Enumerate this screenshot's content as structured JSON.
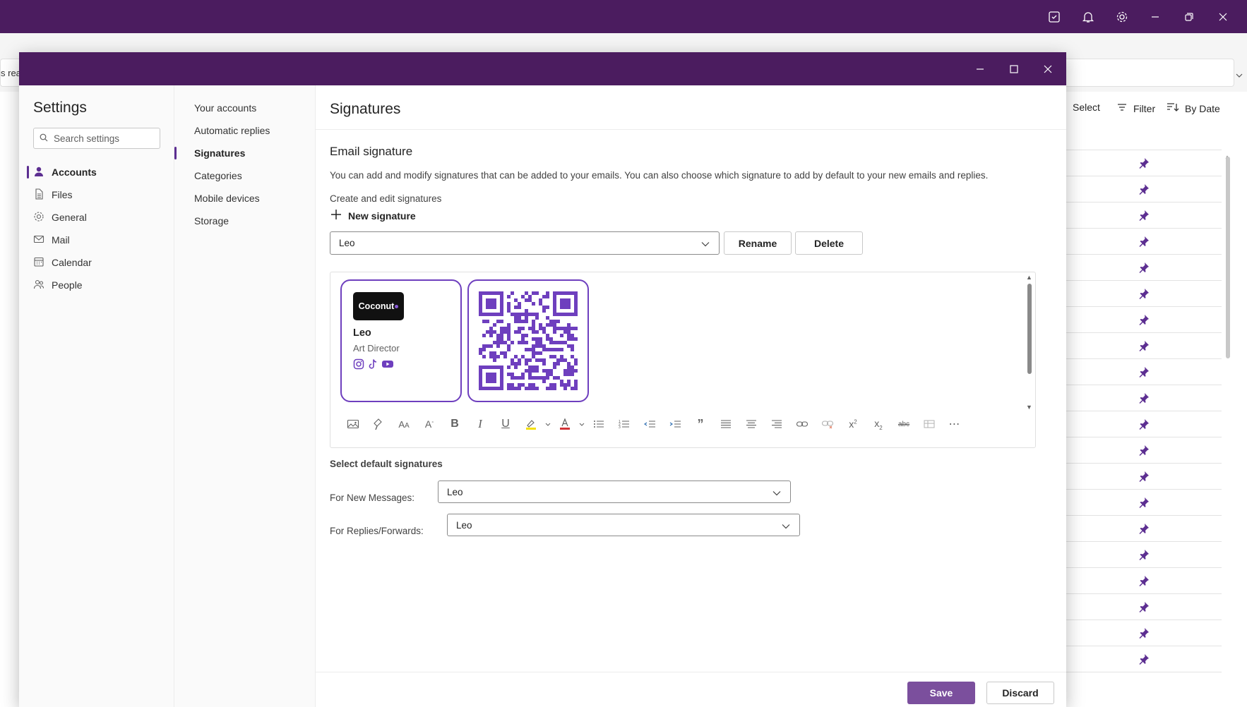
{
  "app": {
    "search_fragment": "s rea",
    "toolbar": {
      "select_label": "Select",
      "filter_label": "Filter",
      "sort_label": "By Date"
    }
  },
  "settings": {
    "title": "Settings",
    "search_placeholder": "Search settings",
    "nav": [
      {
        "label": "Accounts",
        "icon": "person-icon",
        "active": true
      },
      {
        "label": "Files",
        "icon": "file-icon"
      },
      {
        "label": "General",
        "icon": "gear-icon"
      },
      {
        "label": "Mail",
        "icon": "mail-icon"
      },
      {
        "label": "Calendar",
        "icon": "calendar-icon"
      },
      {
        "label": "People",
        "icon": "people-icon"
      }
    ],
    "subnav": [
      {
        "label": "Your accounts"
      },
      {
        "label": "Automatic replies"
      },
      {
        "label": "Signatures",
        "active": true
      },
      {
        "label": "Categories"
      },
      {
        "label": "Mobile devices"
      },
      {
        "label": "Storage"
      }
    ]
  },
  "signatures": {
    "page_title": "Signatures",
    "section_title": "Email signature",
    "description": "You can add and modify signatures that can be added to your emails. You can also choose which signature to add by default to your new emails and replies.",
    "create_heading": "Create and edit signatures",
    "new_signature_label": "New signature",
    "selected_signature": "Leo",
    "rename_label": "Rename",
    "delete_label": "Delete",
    "card": {
      "logo_text": "Coconut",
      "name": "Leo",
      "role": "Art Director",
      "social_icons": [
        "instagram-icon",
        "tiktok-icon",
        "youtube-icon"
      ]
    },
    "accent_color": "#6e3fbe",
    "defaults_heading": "Select default signatures",
    "new_messages_label": "For New Messages:",
    "new_messages_value": "Leo",
    "replies_label": "For Replies/Forwards:",
    "replies_value": "Leo"
  },
  "footer": {
    "save_label": "Save",
    "discard_label": "Discard"
  },
  "colors": {
    "titlebar": "#4b1c5f",
    "primary_button": "#7b4f9d",
    "pin": "#5c2e91"
  }
}
